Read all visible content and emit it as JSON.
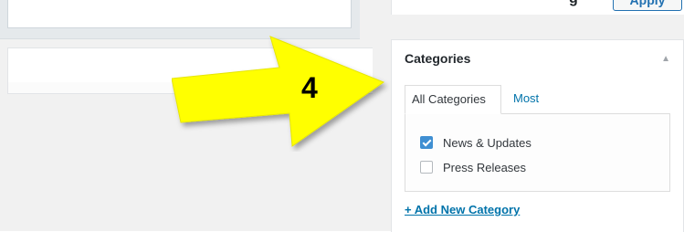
{
  "colors": {
    "arrow": "#ffff00",
    "link": "#0073aa",
    "checkbox_checked": "#3f8fd2"
  },
  "publish": {
    "fragment_text": "g",
    "apply_label": "Apply"
  },
  "categories_box": {
    "title": "Categories",
    "toggle_icon": "triangle-up-icon",
    "toggle_glyph": "▲",
    "tabs": [
      {
        "label": "All Categories",
        "active": true
      },
      {
        "label": "Most Used",
        "active": false
      }
    ],
    "items": [
      {
        "label": "News & Updates",
        "checked": true
      },
      {
        "label": "Press Releases",
        "checked": false
      }
    ],
    "add_link": "+ Add New Category"
  },
  "annotation": {
    "arrow_icon": "arrow-right-icon",
    "number": "4"
  }
}
